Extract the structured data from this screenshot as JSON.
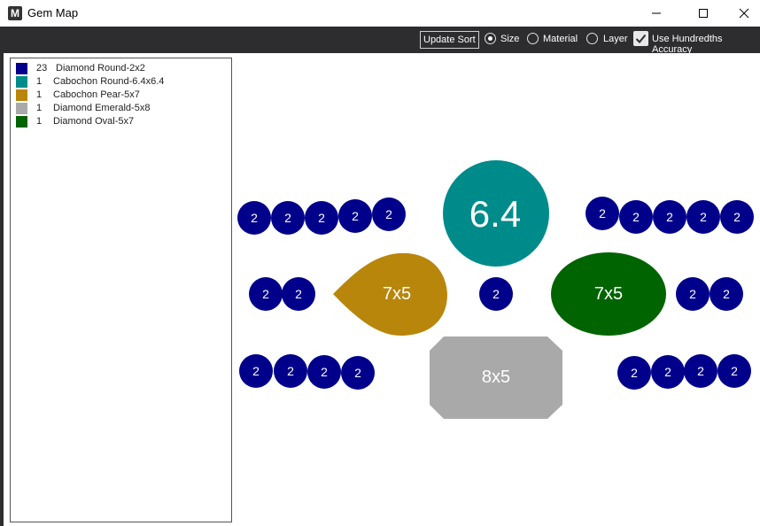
{
  "window": {
    "title": "Gem Map"
  },
  "toolbar": {
    "update_sort_label": "Update Sort",
    "options": [
      {
        "label": "Size",
        "selected": true
      },
      {
        "label": "Material",
        "selected": false
      },
      {
        "label": "Layer",
        "selected": false
      }
    ],
    "hundredths_label": "Use Hundredths Accuracy",
    "hundredths_checked": true
  },
  "legend": [
    {
      "count": "23",
      "name": "Diamond Round-2x2",
      "color": "#00008b"
    },
    {
      "count": "1",
      "name": "Cabochon Round-6.4x6.4",
      "color": "#008b8b"
    },
    {
      "count": "1",
      "name": "Cabochon Pear-5x7",
      "color": "#b8860b"
    },
    {
      "count": "1",
      "name": "Diamond Emerald-5x8",
      "color": "#a9a9a9"
    },
    {
      "count": "1",
      "name": "Diamond Oval-5x7",
      "color": "#006400"
    }
  ],
  "gems": {
    "small_label": "2",
    "center_round_label": "6.4",
    "pear_label": "7x5",
    "oval_label": "7x5",
    "emerald_label": "8x5"
  }
}
